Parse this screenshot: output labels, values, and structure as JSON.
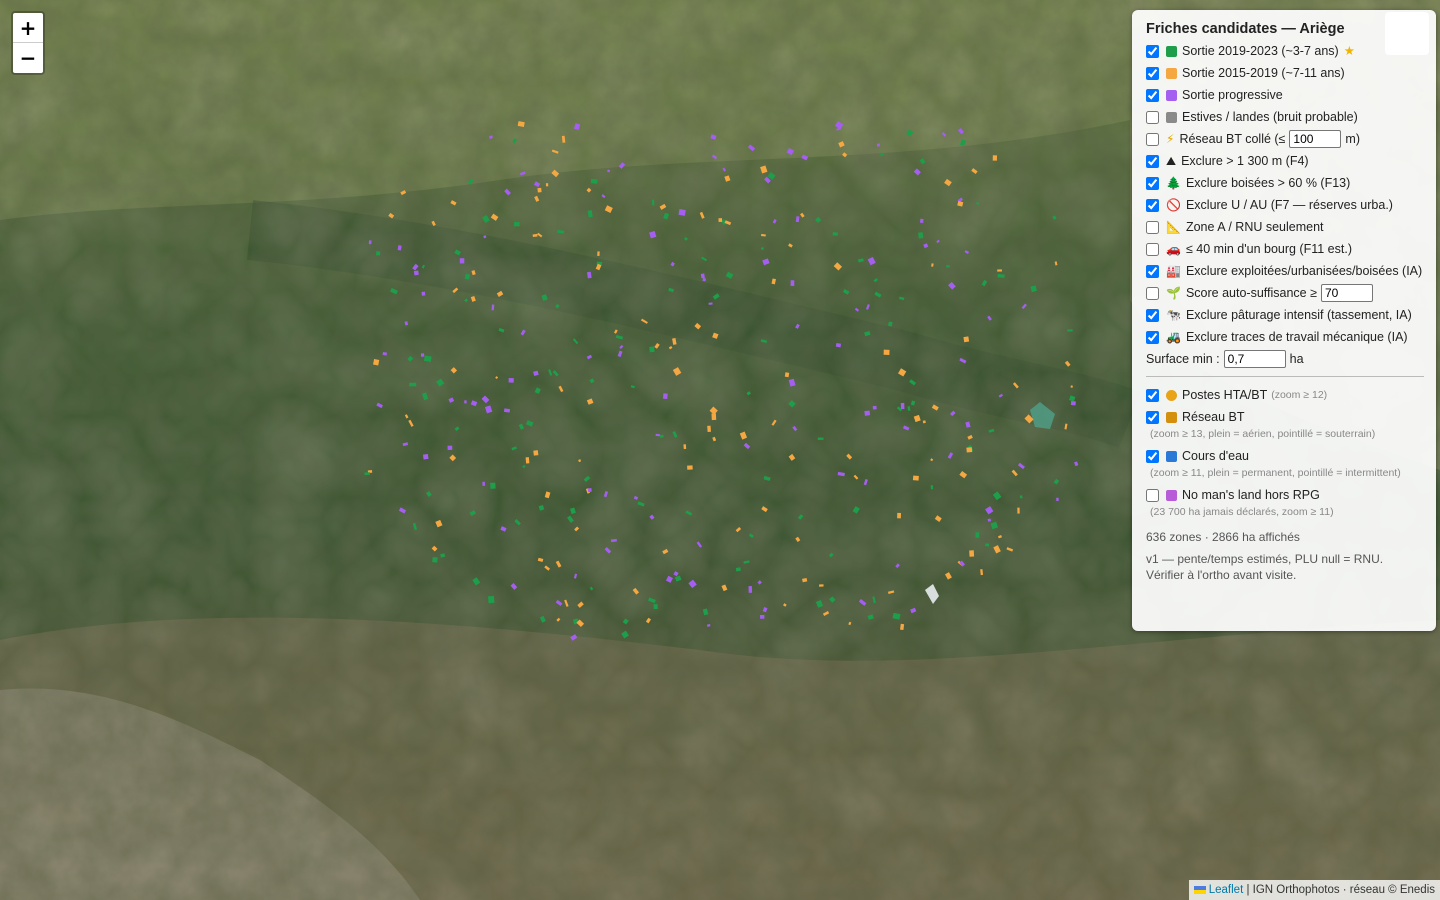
{
  "map": {
    "zoom_in": "+",
    "zoom_out": "−",
    "parcel_colors": {
      "sortie_2019_2023": "#1e9e4a",
      "sortie_2015_2019": "#f5a742",
      "sortie_progressive": "#a45ff0"
    }
  },
  "panel": {
    "title": "Friches candidates — Ariège",
    "layers": [
      {
        "label": "Sortie 2019-2023 (~3-7 ans)",
        "checked": true,
        "color": "#1e9e4a",
        "extra": "★"
      },
      {
        "label": "Sortie 2015-2019 (~7-11 ans)",
        "checked": true,
        "color": "#f5a742"
      },
      {
        "label": "Sortie progressive",
        "checked": true,
        "color": "#a45ff0"
      },
      {
        "label": "Estives / landes (bruit probable)",
        "checked": false,
        "color": "#8a8a8a"
      }
    ],
    "reseau_bt": {
      "icon": "⚡",
      "label_before": "Réseau BT collé (≤",
      "value": "100",
      "label_after": "m)",
      "checked": false
    },
    "filters": [
      {
        "icon": "⛰",
        "label": "Exclure > 1 300 m (F4)",
        "checked": true
      },
      {
        "icon": "🌲",
        "label": "Exclure boisées > 60 % (F13)",
        "checked": true
      },
      {
        "icon": "🚫",
        "label": "Exclure U / AU (F7 — réserves urba.)",
        "checked": true
      },
      {
        "icon": "📐",
        "label": "Zone A / RNU seulement",
        "checked": false
      },
      {
        "icon": "🚗",
        "label": "≤ 40 min d'un bourg (F11 est.)",
        "checked": false
      },
      {
        "icon": "🏭",
        "label": "Exclure exploitées/urbanisées/boisées (IA)",
        "checked": true
      }
    ],
    "score": {
      "icon": "🌱",
      "label": "Score auto-suffisance ≥",
      "value": "70",
      "checked": false
    },
    "filters2": [
      {
        "icon": "🐄",
        "label": "Exclure pâturage intensif (tassement, IA)",
        "checked": true
      },
      {
        "icon": "🚜",
        "label": "Exclure traces de travail mécanique (IA)",
        "checked": true
      }
    ],
    "surface": {
      "label": "Surface min :",
      "value": "0,7",
      "unit": "ha"
    },
    "overlays": [
      {
        "label": "Postes HTA/BT",
        "note": "(zoom ≥ 12)",
        "checked": true,
        "color": "#e8a317",
        "shape": "dot"
      },
      {
        "label": "Réseau BT",
        "note": "(zoom ≥ 13, plein = aérien, pointillé = souterrain)",
        "checked": true,
        "color": "#d4900c",
        "shape": "square"
      },
      {
        "label": "Cours d'eau",
        "note": "(zoom ≥ 11, plein = permanent, pointillé = intermittent)",
        "checked": true,
        "color": "#2a79d6",
        "shape": "square"
      },
      {
        "label": "No man's land hors RPG",
        "note": "(23 700 ha jamais déclarés, zoom ≥ 11)",
        "checked": false,
        "color": "#b85bd8",
        "shape": "square"
      }
    ],
    "stats": "636 zones · 2866 ha affichés",
    "footer": "v1 — pente/temps estimés, PLU null = RNU. Vérifier à l'ortho avant visite."
  },
  "attribution": {
    "leaflet": "Leaflet",
    "rest": " | IGN Orthophotos · réseau © Enedis"
  }
}
